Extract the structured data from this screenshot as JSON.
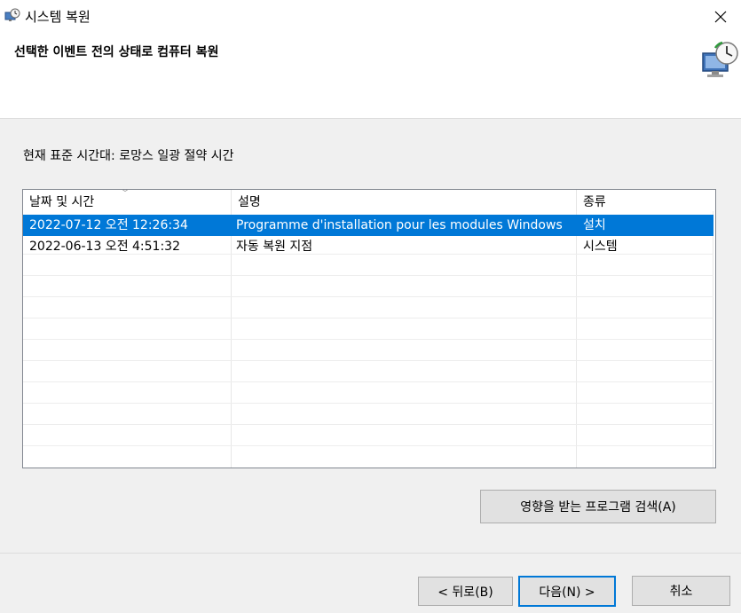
{
  "window": {
    "title": "시스템 복원"
  },
  "header": {
    "title": "선택한 이벤트 전의 상태로 컴퓨터 복원"
  },
  "timezone_label": "현재 표준 시간대: 로망스 일광 절약 시간",
  "table": {
    "columns": [
      "날짜 및 시간",
      "설명",
      "종류"
    ],
    "rows": [
      {
        "date": "2022-07-12 오전 12:26:34",
        "description": "Programme d'installation pour les modules Windows",
        "type": "설치",
        "selected": true
      },
      {
        "date": "2022-06-13 오전 4:51:32",
        "description": "자동 복원 지점",
        "type": "시스템",
        "selected": false
      }
    ]
  },
  "buttons": {
    "scan": "영향을 받는 프로그램 검색(A)",
    "back": "< 뒤로(B)",
    "next": "다음(N) >",
    "cancel": "취소"
  },
  "colors": {
    "selection": "#0078d7",
    "window_bg": "#f0f0f0"
  }
}
